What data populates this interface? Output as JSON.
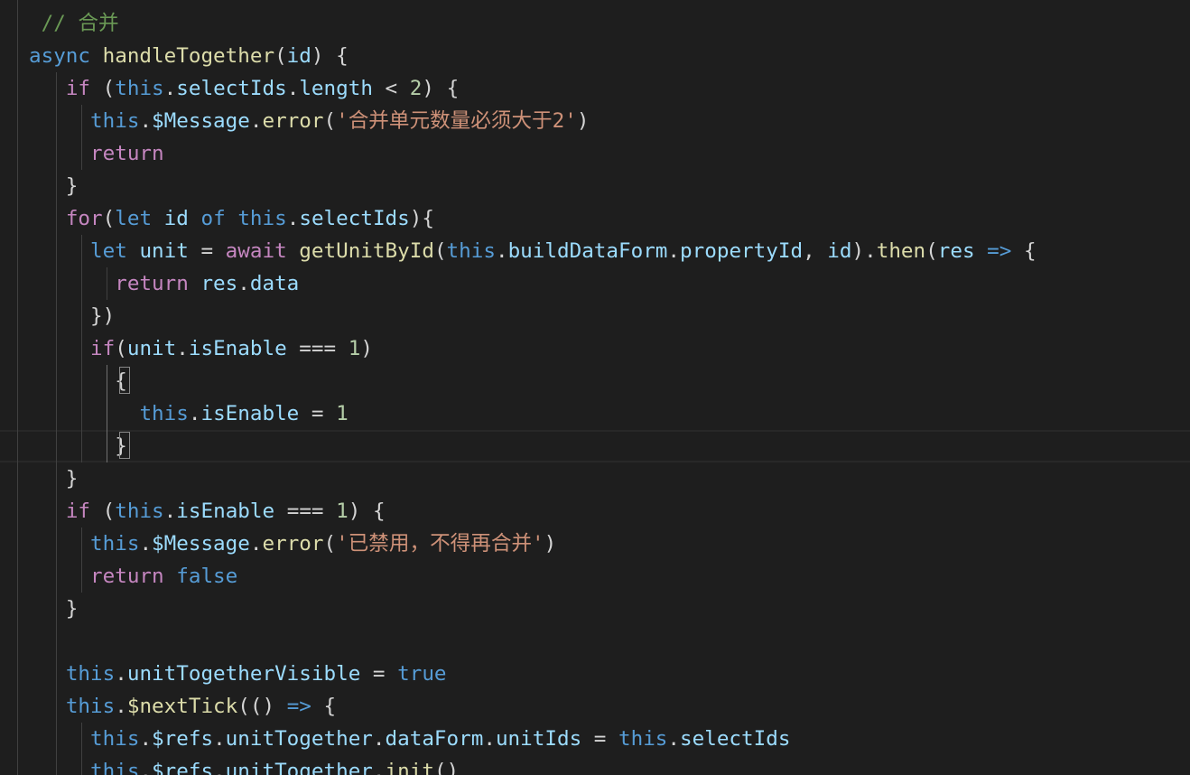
{
  "theme": {
    "background": "#1e1e1e",
    "default_text": "#d4d4d4",
    "keyword_blue": "#569cd6",
    "control_purple": "#c586c0",
    "function_yellow": "#dcdcaa",
    "variable_lightblue": "#9cdcfe",
    "string_orange": "#ce9178",
    "number_green": "#b5cea8",
    "comment_green": "#6a9955",
    "builtin_teal": "#4fc1ff"
  },
  "code": {
    "lines": [
      {
        "tokens": [
          {
            "t": " // 合并",
            "c": "comment"
          }
        ]
      },
      {
        "tokens": [
          {
            "t": "async",
            "c": "keyword"
          },
          {
            "t": " ",
            "c": "plain"
          },
          {
            "t": "handleTogether",
            "c": "function"
          },
          {
            "t": "(",
            "c": "plain"
          },
          {
            "t": "id",
            "c": "variable"
          },
          {
            "t": ") {",
            "c": "plain"
          }
        ]
      },
      {
        "tokens": [
          {
            "t": "   ",
            "c": "plain"
          },
          {
            "t": "if",
            "c": "control"
          },
          {
            "t": " (",
            "c": "plain"
          },
          {
            "t": "this",
            "c": "keyword"
          },
          {
            "t": ".",
            "c": "plain"
          },
          {
            "t": "selectIds",
            "c": "variable"
          },
          {
            "t": ".",
            "c": "plain"
          },
          {
            "t": "length",
            "c": "variable"
          },
          {
            "t": " < ",
            "c": "plain"
          },
          {
            "t": "2",
            "c": "number"
          },
          {
            "t": ") {",
            "c": "plain"
          }
        ]
      },
      {
        "tokens": [
          {
            "t": "     ",
            "c": "plain"
          },
          {
            "t": "this",
            "c": "keyword"
          },
          {
            "t": ".",
            "c": "plain"
          },
          {
            "t": "$Message",
            "c": "variable"
          },
          {
            "t": ".",
            "c": "plain"
          },
          {
            "t": "error",
            "c": "function"
          },
          {
            "t": "(",
            "c": "plain"
          },
          {
            "t": "'合并单元数量必须大于2'",
            "c": "string"
          },
          {
            "t": ")",
            "c": "plain"
          }
        ]
      },
      {
        "tokens": [
          {
            "t": "     ",
            "c": "plain"
          },
          {
            "t": "return",
            "c": "control"
          }
        ]
      },
      {
        "tokens": [
          {
            "t": "   }",
            "c": "plain"
          }
        ]
      },
      {
        "tokens": [
          {
            "t": "   ",
            "c": "plain"
          },
          {
            "t": "for",
            "c": "control"
          },
          {
            "t": "(",
            "c": "plain"
          },
          {
            "t": "let",
            "c": "keyword"
          },
          {
            "t": " ",
            "c": "plain"
          },
          {
            "t": "id",
            "c": "variable"
          },
          {
            "t": " ",
            "c": "plain"
          },
          {
            "t": "of",
            "c": "keyword"
          },
          {
            "t": " ",
            "c": "plain"
          },
          {
            "t": "this",
            "c": "keyword"
          },
          {
            "t": ".",
            "c": "plain"
          },
          {
            "t": "selectIds",
            "c": "variable"
          },
          {
            "t": "){",
            "c": "plain"
          }
        ]
      },
      {
        "tokens": [
          {
            "t": "     ",
            "c": "plain"
          },
          {
            "t": "let",
            "c": "keyword"
          },
          {
            "t": " ",
            "c": "plain"
          },
          {
            "t": "unit",
            "c": "variable"
          },
          {
            "t": " = ",
            "c": "plain"
          },
          {
            "t": "await",
            "c": "control"
          },
          {
            "t": " ",
            "c": "plain"
          },
          {
            "t": "getUnitById",
            "c": "function"
          },
          {
            "t": "(",
            "c": "plain"
          },
          {
            "t": "this",
            "c": "keyword"
          },
          {
            "t": ".",
            "c": "plain"
          },
          {
            "t": "buildDataForm",
            "c": "variable"
          },
          {
            "t": ".",
            "c": "plain"
          },
          {
            "t": "propertyId",
            "c": "variable"
          },
          {
            "t": ", ",
            "c": "plain"
          },
          {
            "t": "id",
            "c": "variable"
          },
          {
            "t": ").",
            "c": "plain"
          },
          {
            "t": "then",
            "c": "function"
          },
          {
            "t": "(",
            "c": "plain"
          },
          {
            "t": "res",
            "c": "variable"
          },
          {
            "t": " ",
            "c": "plain"
          },
          {
            "t": "=>",
            "c": "keyword"
          },
          {
            "t": " {",
            "c": "plain"
          }
        ]
      },
      {
        "tokens": [
          {
            "t": "       ",
            "c": "plain"
          },
          {
            "t": "return",
            "c": "control"
          },
          {
            "t": " ",
            "c": "plain"
          },
          {
            "t": "res",
            "c": "variable"
          },
          {
            "t": ".",
            "c": "plain"
          },
          {
            "t": "data",
            "c": "variable"
          }
        ]
      },
      {
        "tokens": [
          {
            "t": "     })",
            "c": "plain"
          }
        ]
      },
      {
        "tokens": [
          {
            "t": "     ",
            "c": "plain"
          },
          {
            "t": "if",
            "c": "control"
          },
          {
            "t": "(",
            "c": "plain"
          },
          {
            "t": "unit",
            "c": "variable"
          },
          {
            "t": ".",
            "c": "plain"
          },
          {
            "t": "isEnable",
            "c": "variable"
          },
          {
            "t": " === ",
            "c": "plain"
          },
          {
            "t": "1",
            "c": "number"
          },
          {
            "t": ")",
            "c": "plain"
          }
        ]
      },
      {
        "tokens": [
          {
            "t": "       {",
            "c": "plain"
          }
        ]
      },
      {
        "tokens": [
          {
            "t": "         ",
            "c": "plain"
          },
          {
            "t": "this",
            "c": "keyword"
          },
          {
            "t": ".",
            "c": "plain"
          },
          {
            "t": "isEnable",
            "c": "variable"
          },
          {
            "t": " = ",
            "c": "plain"
          },
          {
            "t": "1",
            "c": "number"
          }
        ]
      },
      {
        "tokens": [
          {
            "t": "       }",
            "c": "plain"
          }
        ]
      },
      {
        "tokens": [
          {
            "t": "   }",
            "c": "plain"
          }
        ]
      },
      {
        "tokens": [
          {
            "t": "   ",
            "c": "plain"
          },
          {
            "t": "if",
            "c": "control"
          },
          {
            "t": " (",
            "c": "plain"
          },
          {
            "t": "this",
            "c": "keyword"
          },
          {
            "t": ".",
            "c": "plain"
          },
          {
            "t": "isEnable",
            "c": "variable"
          },
          {
            "t": " === ",
            "c": "plain"
          },
          {
            "t": "1",
            "c": "number"
          },
          {
            "t": ") {",
            "c": "plain"
          }
        ]
      },
      {
        "tokens": [
          {
            "t": "     ",
            "c": "plain"
          },
          {
            "t": "this",
            "c": "keyword"
          },
          {
            "t": ".",
            "c": "plain"
          },
          {
            "t": "$Message",
            "c": "variable"
          },
          {
            "t": ".",
            "c": "plain"
          },
          {
            "t": "error",
            "c": "function"
          },
          {
            "t": "(",
            "c": "plain"
          },
          {
            "t": "'已禁用，不得再合并'",
            "c": "string"
          },
          {
            "t": ")",
            "c": "plain"
          }
        ]
      },
      {
        "tokens": [
          {
            "t": "     ",
            "c": "plain"
          },
          {
            "t": "return",
            "c": "control"
          },
          {
            "t": " ",
            "c": "plain"
          },
          {
            "t": "false",
            "c": "keyword"
          }
        ]
      },
      {
        "tokens": [
          {
            "t": "   }",
            "c": "plain"
          }
        ]
      },
      {
        "tokens": []
      },
      {
        "tokens": [
          {
            "t": "   ",
            "c": "plain"
          },
          {
            "t": "this",
            "c": "keyword"
          },
          {
            "t": ".",
            "c": "plain"
          },
          {
            "t": "unitTogetherVisible",
            "c": "variable"
          },
          {
            "t": " = ",
            "c": "plain"
          },
          {
            "t": "true",
            "c": "keyword"
          }
        ]
      },
      {
        "tokens": [
          {
            "t": "   ",
            "c": "plain"
          },
          {
            "t": "this",
            "c": "keyword"
          },
          {
            "t": ".",
            "c": "plain"
          },
          {
            "t": "$nextTick",
            "c": "function"
          },
          {
            "t": "(() ",
            "c": "plain"
          },
          {
            "t": "=>",
            "c": "keyword"
          },
          {
            "t": " {",
            "c": "plain"
          }
        ]
      },
      {
        "tokens": [
          {
            "t": "     ",
            "c": "plain"
          },
          {
            "t": "this",
            "c": "keyword"
          },
          {
            "t": ".",
            "c": "plain"
          },
          {
            "t": "$refs",
            "c": "variable"
          },
          {
            "t": ".",
            "c": "plain"
          },
          {
            "t": "unitTogether",
            "c": "variable"
          },
          {
            "t": ".",
            "c": "plain"
          },
          {
            "t": "dataForm",
            "c": "variable"
          },
          {
            "t": ".",
            "c": "plain"
          },
          {
            "t": "unitIds",
            "c": "variable"
          },
          {
            "t": " = ",
            "c": "plain"
          },
          {
            "t": "this",
            "c": "keyword"
          },
          {
            "t": ".",
            "c": "plain"
          },
          {
            "t": "selectIds",
            "c": "variable"
          }
        ]
      },
      {
        "tokens": [
          {
            "t": "     ",
            "c": "plain"
          },
          {
            "t": "this",
            "c": "keyword"
          },
          {
            "t": ".",
            "c": "plain"
          },
          {
            "t": "$refs",
            "c": "variable"
          },
          {
            "t": ".",
            "c": "plain"
          },
          {
            "t": "unitTogether",
            "c": "variable"
          },
          {
            "t": ".",
            "c": "plain"
          },
          {
            "t": "init",
            "c": "function"
          },
          {
            "t": "()",
            "c": "plain"
          }
        ]
      }
    ]
  }
}
